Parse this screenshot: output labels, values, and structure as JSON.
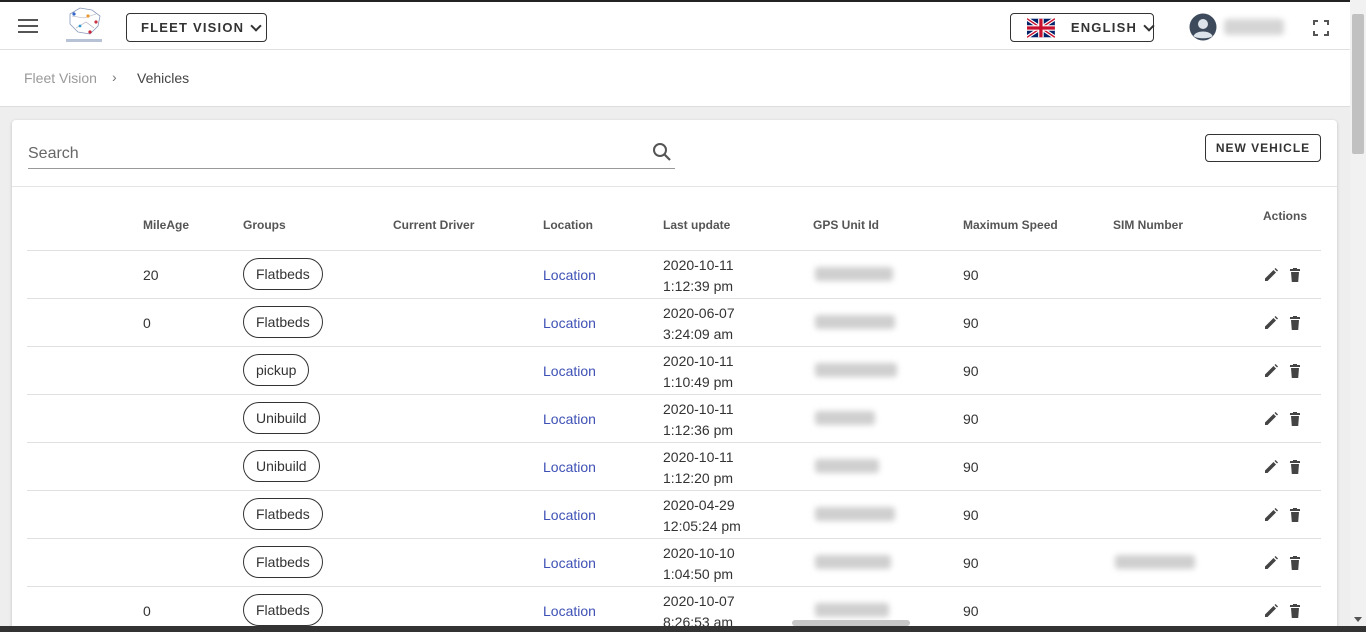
{
  "header": {
    "fleet_label": "FLEET VISION",
    "language_label": "ENGLISH"
  },
  "breadcrumb": {
    "root": "Fleet Vision",
    "separator": "›",
    "current": "Vehicles"
  },
  "search": {
    "placeholder": "Search",
    "value": ""
  },
  "toolbar": {
    "new_vehicle_label": "NEW VEHICLE"
  },
  "table": {
    "columns": [
      "MileAge",
      "Groups",
      "Current Driver",
      "Location",
      "Last update",
      "GPS Unit Id",
      "Maximum Speed",
      "SIM Number",
      "Actions"
    ],
    "rows": [
      {
        "mileage": "20",
        "group": "Flatbeds",
        "driver": "",
        "location": "Location",
        "date": "2020-10-11",
        "time": "1:12:39 pm",
        "max_speed": "90"
      },
      {
        "mileage": "0",
        "group": "Flatbeds",
        "driver": "",
        "location": "Location",
        "date": "2020-06-07",
        "time": "3:24:09 am",
        "max_speed": "90"
      },
      {
        "mileage": "",
        "group": "pickup",
        "driver": "",
        "location": "Location",
        "date": "2020-10-11",
        "time": "1:10:49 pm",
        "max_speed": "90"
      },
      {
        "mileage": "",
        "group": "Unibuild",
        "driver": "",
        "location": "Location",
        "date": "2020-10-11",
        "time": "1:12:36 pm",
        "max_speed": "90"
      },
      {
        "mileage": "",
        "group": "Unibuild",
        "driver": "",
        "location": "Location",
        "date": "2020-10-11",
        "time": "1:12:20 pm",
        "max_speed": "90"
      },
      {
        "mileage": "",
        "group": "Flatbeds",
        "driver": "",
        "location": "Location",
        "date": "2020-04-29",
        "time": "12:05:24 pm",
        "max_speed": "90"
      },
      {
        "mileage": "",
        "group": "Flatbeds",
        "driver": "",
        "location": "Location",
        "date": "2020-10-10",
        "time": "1:04:50 pm",
        "max_speed": "90"
      },
      {
        "mileage": "0",
        "group": "Flatbeds",
        "driver": "",
        "location": "Location",
        "date": "2020-10-07",
        "time": "8:26:53 am",
        "max_speed": "90"
      }
    ]
  },
  "colors": {
    "link": "#3f51b5",
    "border": "#333333",
    "background": "#eeeeee"
  },
  "icons": [
    "menu-icon",
    "chevron-down-icon",
    "uk-flag-icon",
    "user-avatar-icon",
    "fullscreen-icon",
    "search-icon",
    "edit-icon",
    "delete-icon"
  ]
}
